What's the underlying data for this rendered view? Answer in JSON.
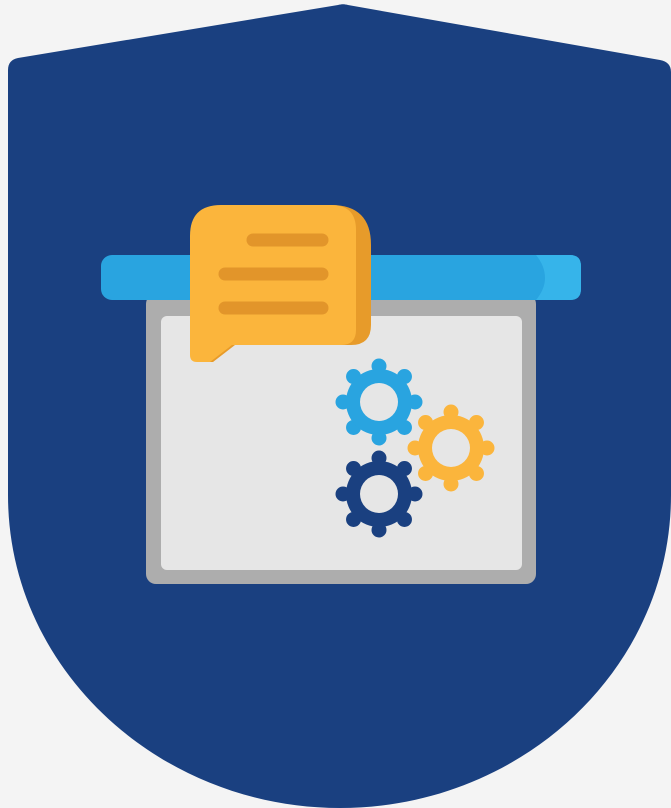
{
  "icon": {
    "name": "presentation-board-settings-shield-icon",
    "shield": "shield-icon",
    "board": "presentation-board-icon",
    "speech_bubble": "speech-bubble-icon",
    "gears": [
      "gear-icon",
      "gear-icon",
      "gear-icon"
    ]
  },
  "colors": {
    "background": "#f4f4f4",
    "shield": "#1a4080",
    "rail": "#29a4e0",
    "rail_cap": "#36b4ea",
    "board_frame": "#adadad",
    "board_panel": "#e6e6e6",
    "bubble": "#fbb53c",
    "bubble_shadow": "#e79b2a",
    "bubble_lines": "#e2952a",
    "gear_blue": "#29a4e0",
    "gear_yellow": "#fbb53c",
    "gear_navy": "#1a4080",
    "gear_hole": "#e6e6e6"
  }
}
